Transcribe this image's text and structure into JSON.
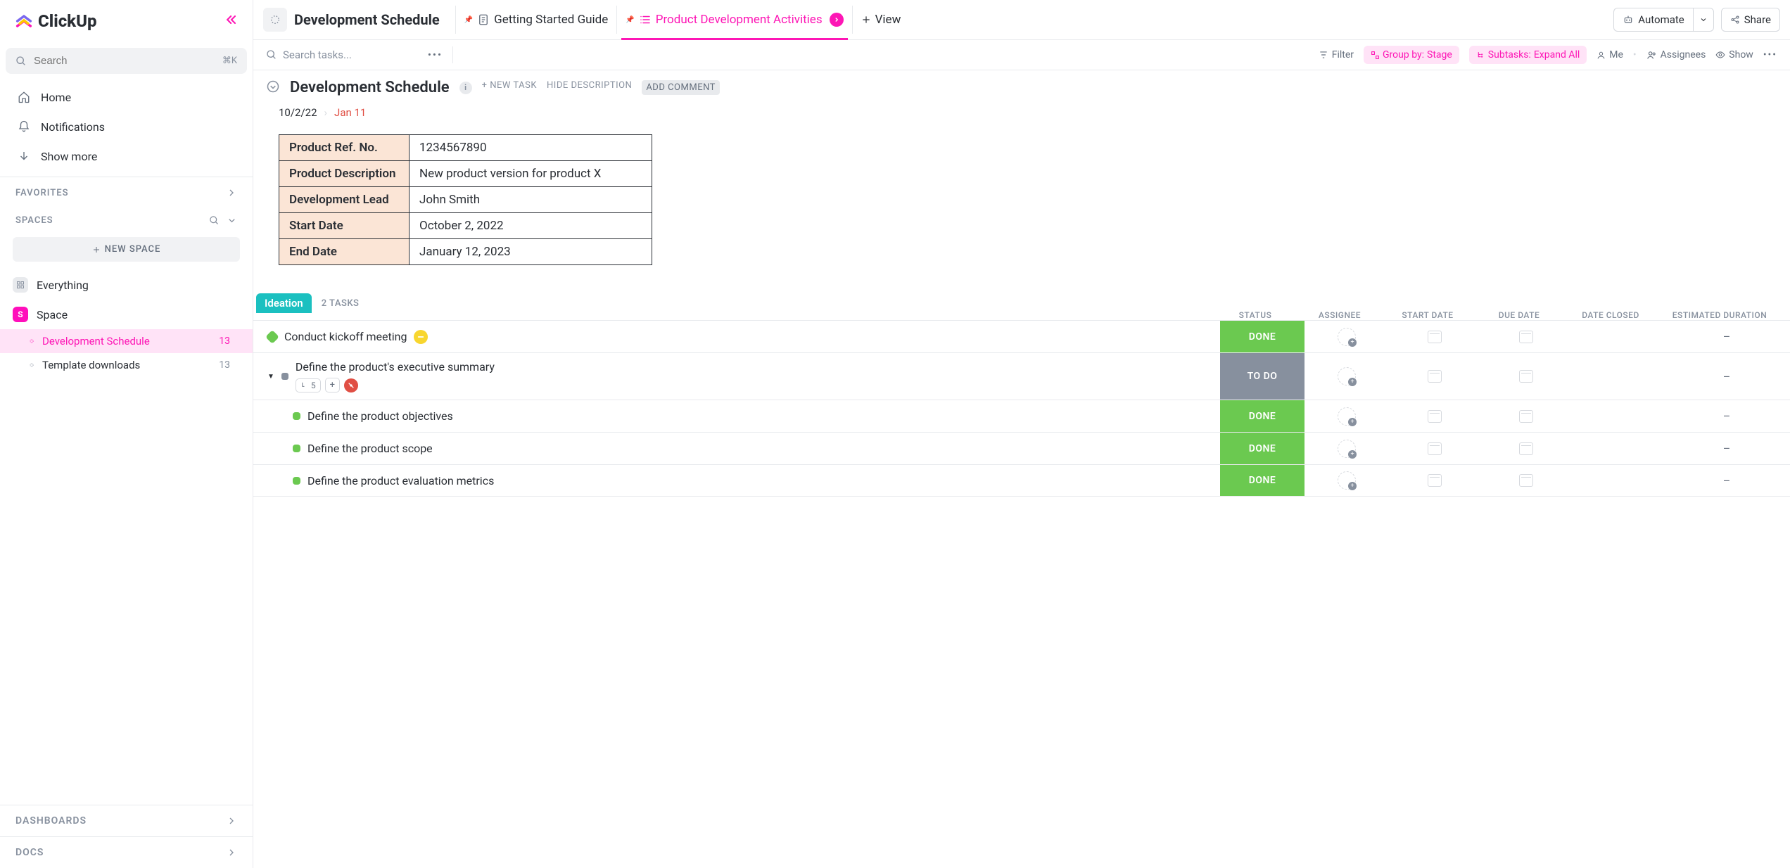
{
  "logo": "ClickUp",
  "search": {
    "placeholder": "Search",
    "shortcut": "⌘K"
  },
  "nav": [
    {
      "label": "Home",
      "icon": "home"
    },
    {
      "label": "Notifications",
      "icon": "bell"
    },
    {
      "label": "Show more",
      "icon": "arrow-down"
    }
  ],
  "sections": {
    "favorites": "FAVORITES",
    "spaces": "SPACES",
    "dashboards": "DASHBOARDS",
    "docs": "DOCS"
  },
  "new_space": "NEW SPACE",
  "spaces": [
    {
      "label": "Everything"
    },
    {
      "label": "Space",
      "letter": "S"
    }
  ],
  "lists": [
    {
      "label": "Development Schedule",
      "count": "13",
      "active": true
    },
    {
      "label": "Template downloads",
      "count": "13",
      "active": false
    }
  ],
  "breadcrumb": "Development Schedule",
  "tabs": [
    {
      "label": "Getting Started Guide",
      "active": false
    },
    {
      "label": "Product Development Activities",
      "active": true
    }
  ],
  "add_view": "View",
  "automate": "Automate",
  "share": "Share",
  "toolbar": {
    "search_placeholder": "Search tasks...",
    "filter": "Filter",
    "group_by": "Group by:",
    "group_value": "Stage",
    "subtasks": "Subtasks:",
    "subtasks_value": "Expand All",
    "me": "Me",
    "assignees": "Assignees",
    "show": "Show"
  },
  "doc": {
    "title": "Development Schedule",
    "new_task": "+ NEW TASK",
    "hide_desc": "HIDE DESCRIPTION",
    "add_comment": "ADD COMMENT",
    "start_date": "10/2/22",
    "due_date": "Jan 11"
  },
  "info": [
    {
      "k": "Product Ref. No.",
      "v": "1234567890"
    },
    {
      "k": "Product Description",
      "v": "New product version for product X"
    },
    {
      "k": "Development Lead",
      "v": "John Smith"
    },
    {
      "k": "Start Date",
      "v": "October 2, 2022"
    },
    {
      "k": "End Date",
      "v": "January 12, 2023"
    }
  ],
  "group": {
    "name": "Ideation",
    "count": "2 TASKS"
  },
  "columns": [
    "STATUS",
    "ASSIGNEE",
    "START DATE",
    "DUE DATE",
    "DATE CLOSED",
    "ESTIMATED DURATION"
  ],
  "tasks": [
    {
      "title": "Conduct kickoff meeting",
      "status": "DONE",
      "status_key": "done",
      "priority": "yellow",
      "sub": false,
      "dash": "–"
    },
    {
      "title": "Define the product's executive summary",
      "status": "TO DO",
      "status_key": "todo",
      "priority": "red",
      "sub": false,
      "subtask_count": "5",
      "expandable": true,
      "dash": "–"
    },
    {
      "title": "Define the product objectives",
      "status": "DONE",
      "status_key": "done",
      "sub": true,
      "dash": "–"
    },
    {
      "title": "Define the product scope",
      "status": "DONE",
      "status_key": "done",
      "sub": true,
      "dash": "–"
    },
    {
      "title": "Define the product evaluation metrics",
      "status": "DONE",
      "status_key": "done",
      "sub": true,
      "dash": "–"
    }
  ]
}
